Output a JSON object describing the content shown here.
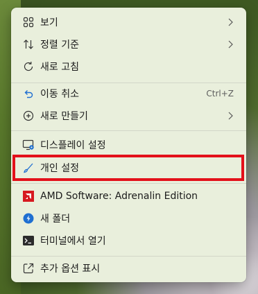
{
  "menu": {
    "items": [
      {
        "label": "보기",
        "icon": "grid-view-icon",
        "submenu": true
      },
      {
        "label": "정렬 기준",
        "icon": "sort-arrows-icon",
        "submenu": true
      },
      {
        "label": "새로 고침",
        "icon": "refresh-icon",
        "submenu": false
      },
      {
        "label": "이동 취소",
        "icon": "undo-icon",
        "shortcut": "Ctrl+Z"
      },
      {
        "label": "새로 만들기",
        "icon": "plus-circle-icon",
        "submenu": true
      },
      {
        "label": "디스플레이 설정",
        "icon": "display-settings-icon"
      },
      {
        "label": "개인 설정",
        "icon": "brush-icon",
        "highlighted": true
      },
      {
        "label": "AMD Software: Adrenalin Edition",
        "icon": "amd-logo-icon"
      },
      {
        "label": "새 폴더",
        "icon": "new-folder-icon"
      },
      {
        "label": "터미널에서 열기",
        "icon": "terminal-icon"
      },
      {
        "label": "추가 옵션 표시",
        "icon": "external-open-icon"
      }
    ]
  },
  "colors": {
    "menu_bg": "#e9efdc",
    "highlight_border": "#e3101a",
    "amd_red": "#d71920",
    "accent_blue": "#1f6fd1"
  }
}
